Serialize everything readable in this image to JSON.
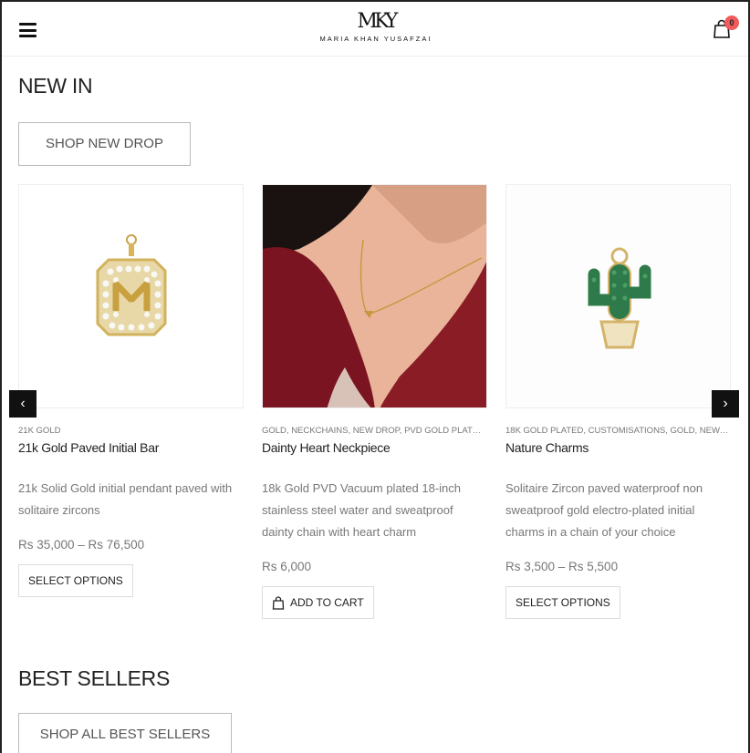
{
  "header": {
    "logo_mark": "MKY",
    "logo_text": "MARIA KHAN YUSAFZAI",
    "cart_count": "0"
  },
  "new_in": {
    "title": "NEW IN",
    "button": "SHOP NEW DROP"
  },
  "products": [
    {
      "category": "21K GOLD",
      "name": "21k Gold Paved Initial Bar",
      "description": "21k Solid Gold initial pendant paved with solitaire zircons",
      "price": "Rs 35,000 – Rs 76,500",
      "button": "SELECT OPTIONS",
      "image_icon": "gold-initial-pendant-image"
    },
    {
      "category": "GOLD, NECKCHAINS, NEW DROP, PVD GOLD PLATED, ...",
      "name": "Dainty Heart Neckpiece",
      "description": "18k Gold PVD Vacuum plated 18-inch stainless steel water and sweatproof dainty chain with heart charm",
      "price": "Rs 6,000",
      "button": "ADD TO CART",
      "image_icon": "model-necklace-image"
    },
    {
      "category": "18K GOLD PLATED, CUSTOMISATIONS, GOLD, NEW DR...",
      "name": "Nature Charms",
      "description": "Solitaire Zircon paved waterproof non sweatproof gold electro-plated initial charms in a chain of your choice",
      "price": "Rs 3,500 – Rs 5,500",
      "button": "SELECT OPTIONS",
      "image_icon": "cactus-charm-image"
    }
  ],
  "carousel": {
    "prev_icon": "chevron-left-icon",
    "next_icon": "chevron-right-icon",
    "prev_glyph": "‹",
    "next_glyph": "›"
  },
  "best_sellers": {
    "title": "BEST SELLERS",
    "button": "SHOP ALL BEST SELLERS"
  },
  "colors": {
    "badge": "#f15a5a",
    "text_muted": "#777777",
    "gold": "#d9b45a",
    "maroon": "#7a1420"
  }
}
